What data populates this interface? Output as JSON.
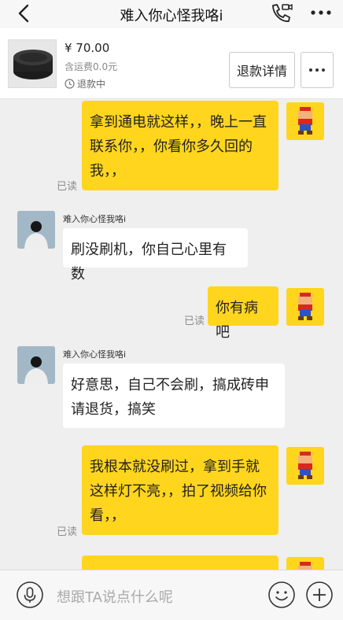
{
  "header": {
    "title": "难入你心怪我咯i",
    "back_icon": "chevron-left-icon",
    "call_icon": "phone-video-icon",
    "more_icon": "more-horizontal-icon"
  },
  "order": {
    "price": "¥ 70.00",
    "shipping": "含运费0.0元",
    "status": "退款中",
    "refund_button": "退款详情"
  },
  "messages": [
    {
      "from": "me",
      "text": "拿到通电就这样，，晚上一直联系你，，你看你多久回的我，，",
      "read": "已读"
    },
    {
      "from": "them",
      "sender": "难入你心怪我咯i",
      "text": "刷没刷机，你自己心里有数"
    },
    {
      "from": "me",
      "text": "你有病吧",
      "read": "已读"
    },
    {
      "from": "them",
      "sender": "难入你心怪我咯i",
      "text": "好意思，自己不会刷，搞成砖申请退货，搞笑"
    },
    {
      "from": "me",
      "text": "我根本就没刷过，拿到手就这样灯不亮，，拍了视频给你看，，",
      "read": "已读"
    }
  ],
  "input": {
    "placeholder": "想跟TA说点什么呢"
  },
  "colors": {
    "my_bubble": "#ffd51e",
    "their_bubble": "#ffffff",
    "background": "#efefef"
  }
}
